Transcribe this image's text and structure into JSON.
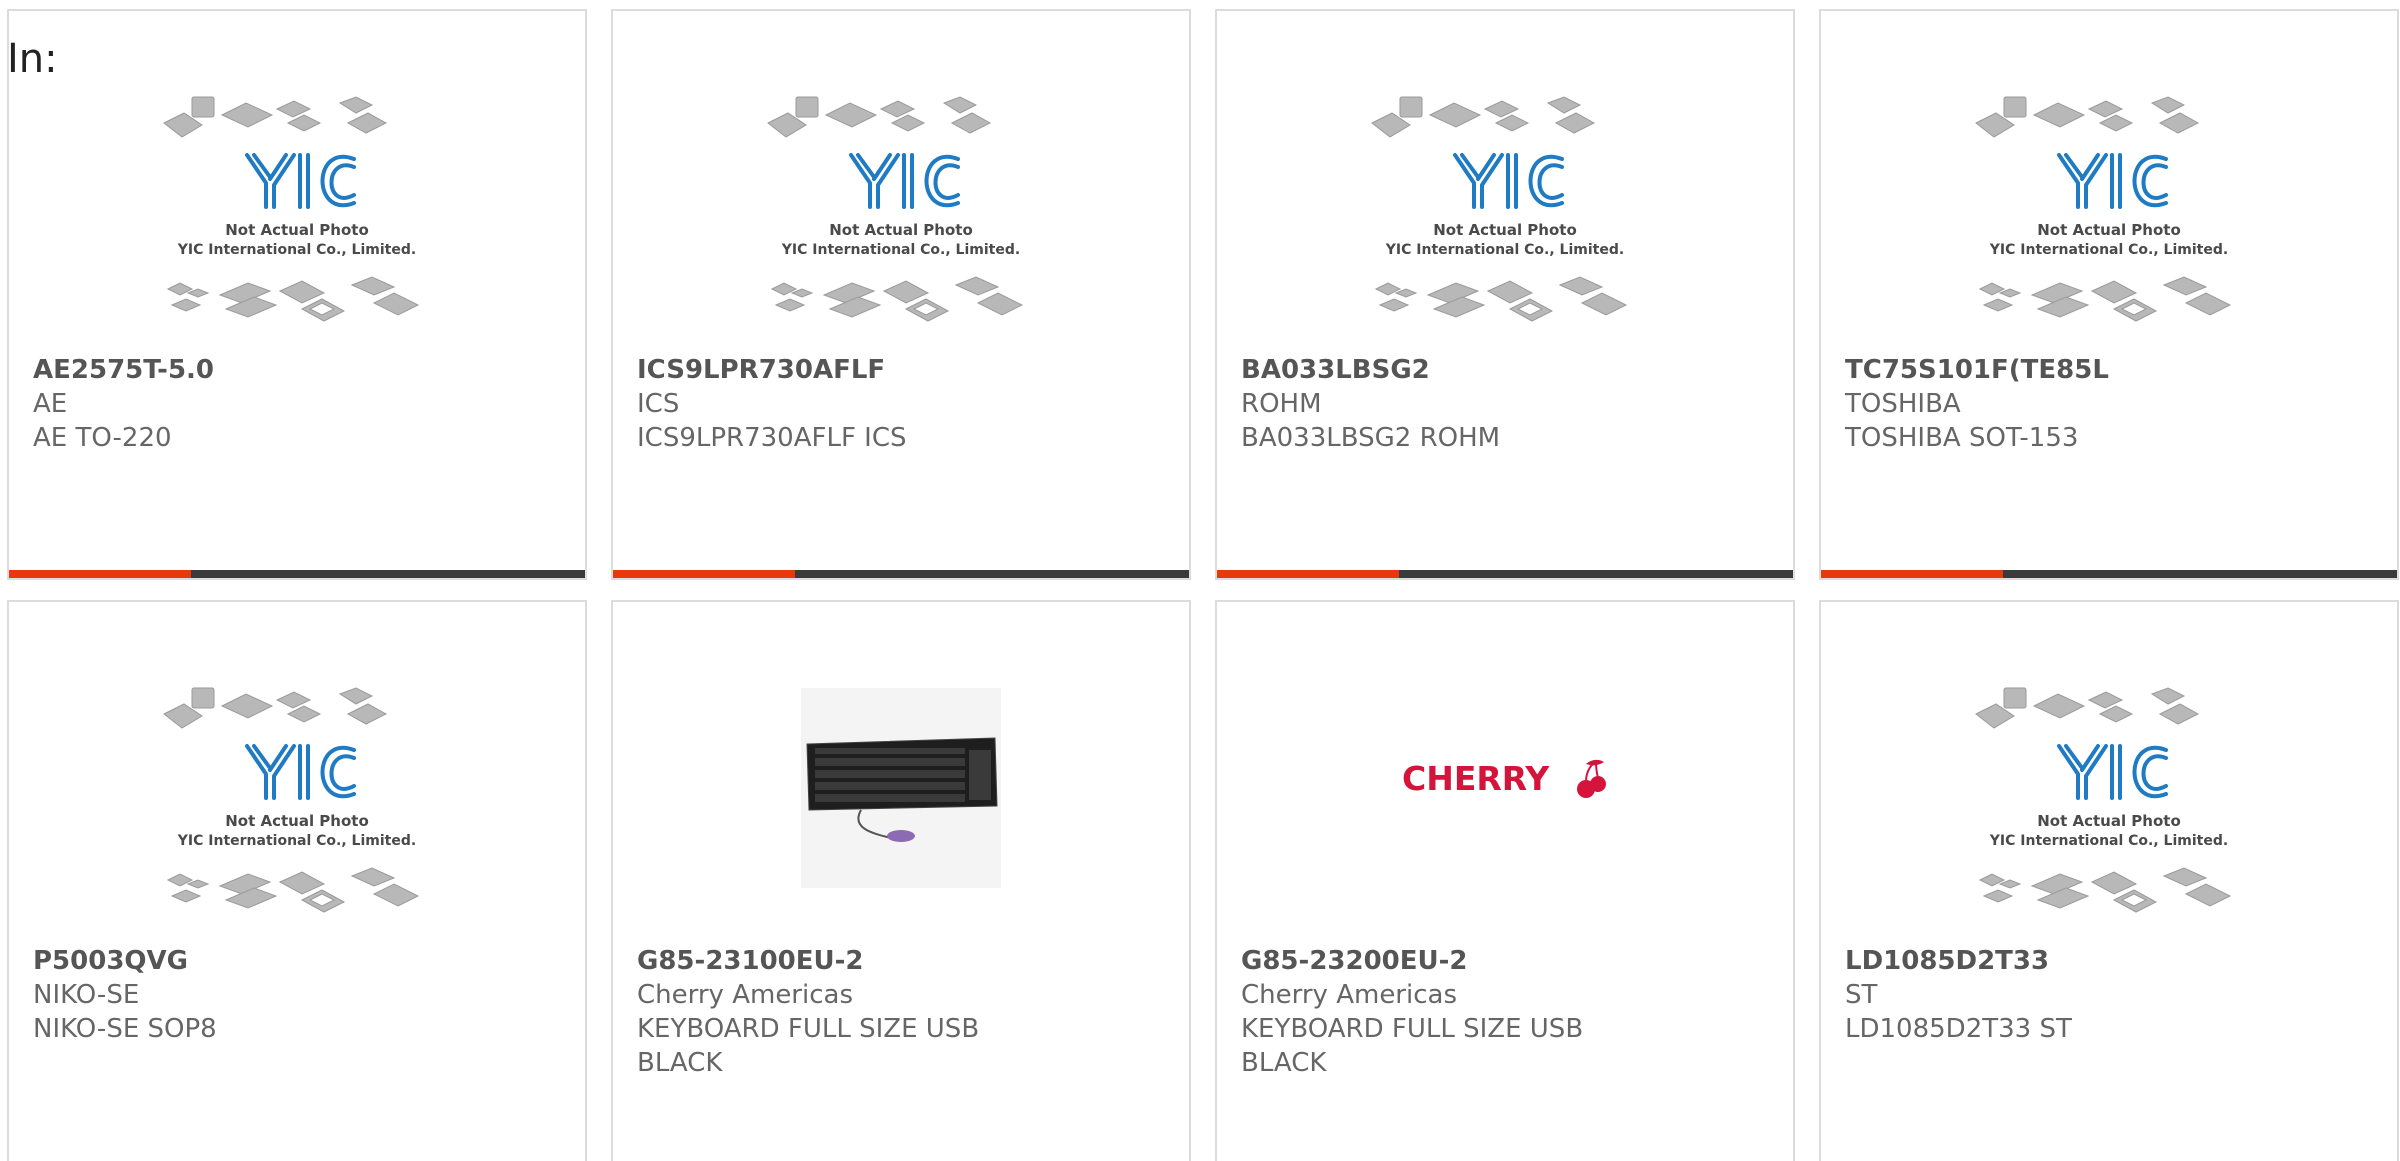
{
  "in_label": "In:",
  "placeholder": {
    "line1": "Not Actual Photo",
    "line2": "YIC International Co., Limited.",
    "logo_text": "YIC"
  },
  "cherry_logo_text": "CHERRY",
  "colors": {
    "accent": "#e8380d",
    "bar": "#3a3a3a",
    "logo_blue": "#1e7bc4",
    "cherry_red": "#d5143c"
  },
  "cards": [
    {
      "part": "AE2575T-5.0",
      "maker": "AE",
      "desc": [
        "AE TO-220"
      ],
      "image": "placeholder"
    },
    {
      "part": "ICS9LPR730AFLF",
      "maker": "ICS",
      "desc": [
        "ICS9LPR730AFLF ICS"
      ],
      "image": "placeholder"
    },
    {
      "part": "BA033LBSG2",
      "maker": "ROHM",
      "desc": [
        "BA033LBSG2 ROHM"
      ],
      "image": "placeholder"
    },
    {
      "part": "TC75S101F(TE85L",
      "maker": "TOSHIBA",
      "desc": [
        "TOSHIBA SOT-153"
      ],
      "image": "placeholder"
    },
    {
      "part": "P5003QVG",
      "maker": "NIKO-SE",
      "desc": [
        "NIKO-SE SOP8"
      ],
      "image": "placeholder"
    },
    {
      "part": "G85-23100EU-2",
      "maker": "Cherry Americas",
      "desc": [
        "KEYBOARD FULL SIZE USB",
        "BLACK"
      ],
      "image": "keyboard"
    },
    {
      "part": "G85-23200EU-2",
      "maker": "Cherry Americas",
      "desc": [
        "KEYBOARD FULL SIZE USB",
        "BLACK"
      ],
      "image": "cherry-logo"
    },
    {
      "part": "LD1085D2T33",
      "maker": "ST",
      "desc": [
        "LD1085D2T33 ST"
      ],
      "image": "placeholder"
    }
  ]
}
